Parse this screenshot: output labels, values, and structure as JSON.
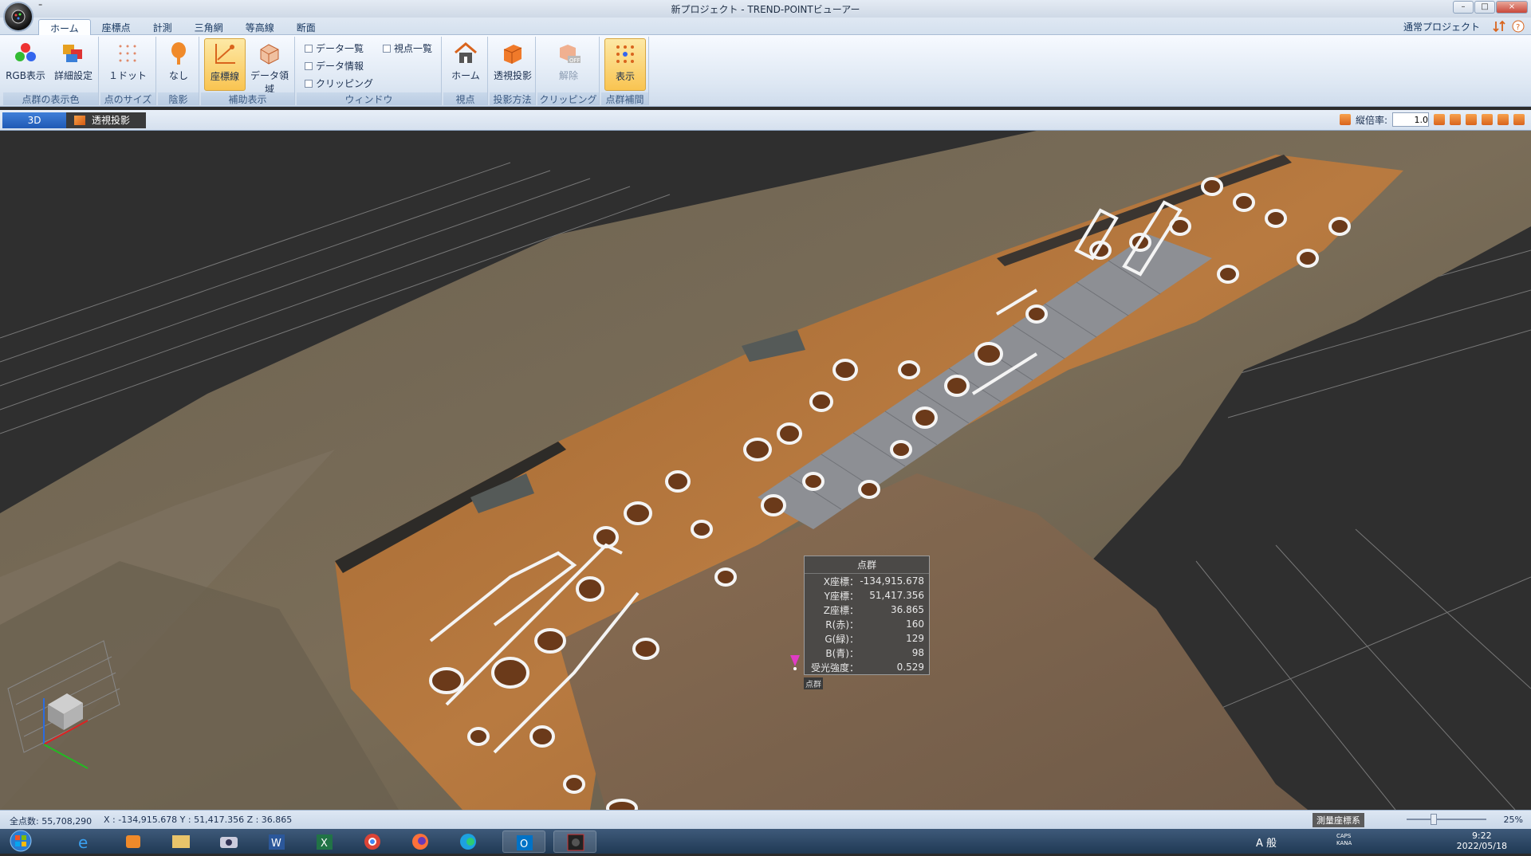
{
  "window": {
    "title": "新プロジェクト - TREND-POINTビューアー",
    "qat_glyph": "⁼"
  },
  "tabs": [
    "ホーム",
    "座標点",
    "計測",
    "三角網",
    "等高線",
    "断面"
  ],
  "project_mode": "通常プロジェクト",
  "ribbon": {
    "groups": {
      "color": "点群の表示色",
      "size": "点のサイズ",
      "shade": "陰影",
      "aux": "補助表示",
      "window": "ウィンドウ",
      "viewpoint": "視点",
      "projection": "投影方法",
      "clipping": "クリッピング",
      "interp": "点群補間"
    },
    "buttons": {
      "rgb": "RGB表示",
      "detail": "詳細設定",
      "dot": "１ドット",
      "none": "なし",
      "axis": "座標線",
      "data_area": "データ領域",
      "home": "ホーム",
      "persp": "透視投影",
      "release": "解除",
      "show": "表示"
    },
    "checks": {
      "data_list": "データ一覧",
      "view_list": "視点一覧",
      "data_info": "データ情報",
      "clipping": "クリッピング"
    }
  },
  "view": {
    "tab_3d": "3D",
    "tab_persp": "透視投影",
    "scale_label": "縦倍率:",
    "scale_value": "1.0"
  },
  "popup": {
    "tag": "点群",
    "title": "点群",
    "rows": [
      {
        "label": "X座標：",
        "value": "-134,915.678"
      },
      {
        "label": "Y座標：",
        "value": "51,417.356"
      },
      {
        "label": "Z座標：",
        "value": "36.865"
      },
      {
        "label": "R(赤)：",
        "value": "160"
      },
      {
        "label": "G(緑)：",
        "value": "129"
      },
      {
        "label": "B(青)：",
        "value": "98"
      },
      {
        "label": "受光強度：",
        "value": "0.529"
      }
    ]
  },
  "statusbar": {
    "total_points": "全点数: 55,708,290",
    "cursor": "X : -134,915.678  Y : 51,417.356  Z : 36.865",
    "coord_system": "測量座標系",
    "zoom": "25%"
  },
  "taskbar": {
    "ime": "A 般",
    "time": "9:22",
    "date": "2022/05/18",
    "caps": "CAPS",
    "kana": "KANA"
  },
  "colors": {
    "accent_blue": "#1f59b5",
    "selected": "#f9c451",
    "soil": "#b0713a",
    "pin": "#e03cc4"
  },
  "icons": [
    "app-orb-icon",
    "rgb-icon",
    "palette-icon",
    "dots-icon",
    "shade-icon",
    "axis-icon",
    "data-area-icon",
    "house-icon",
    "cube-icon",
    "clipping-off-icon",
    "interp-icon",
    "pin-icon",
    "axis-gizmo-icon"
  ]
}
